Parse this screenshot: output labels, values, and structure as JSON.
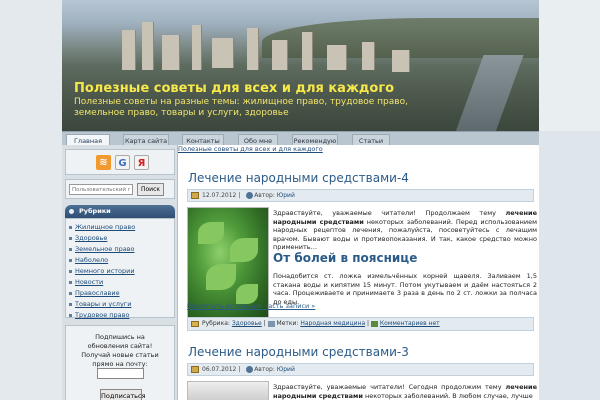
{
  "site": {
    "title": "Полезные советы для всех и для каждого",
    "description": "Полезные советы на разные темы: жилищное право, трудовое право, земельное право, товары и услуги, здоровье"
  },
  "nav": {
    "items": [
      "Главная",
      "Карта сайта",
      "Контакты",
      "Обо мне",
      "Рекомендую",
      "Статьи"
    ],
    "active": "Главная"
  },
  "sidebar": {
    "icons": [
      "rss-icon",
      "google-icon",
      "yandex-icon"
    ],
    "search": {
      "placeholder": "Пользовательский поиск",
      "button": "Поиск"
    },
    "rubrics_title": "Рубрики",
    "rubrics": [
      "Жилищное право",
      "Здоровье",
      "Земельное право",
      "Наболело",
      "Немного истории",
      "Новости",
      "Православие",
      "Товары и услуги",
      "Трудовое право"
    ],
    "subscribe": {
      "text": "Подпишись на обновления сайта! Получай новые статьи прямо на почту:",
      "button": "Подписаться"
    }
  },
  "breadcrumb": "Полезные советы для всех и для каждого",
  "posts": [
    {
      "title": "Лечение народными средствами-4",
      "date": "12.07.2012",
      "author_label": "Автор:",
      "author": "Юрий",
      "intro_start": "Здравствуйте, уважаемые читатели! Продолжаем тему ",
      "intro_bold": "лечение народными средствами",
      "intro_end": " некоторых заболеваний. Перед использованием народных рецептов лечения, пожалуйста, посоветуйтесь с лечащим врачом. Бывают воды и противопоказания. И так, какое средство можно применить…",
      "subtitle": "От болей в пояснице",
      "body": "Понадобится ст. ложка измельчённых корней щавеля. Заливаем 1,5 стакана воды и кипятим 15 минут. Потом укутываем и даём настояться 2 часа. Процеживаете и принимаете 3 раза в день по 2 ст. ложки за полчаса до еды.",
      "more": "Прочитать остальную часть записи »",
      "rubric_label": "Рубрика:",
      "rubric": "Здоровье",
      "tags_label": "Метки:",
      "tags": "Народная медицина",
      "comments": "Комментариев нет"
    },
    {
      "title": "Лечение народными средствами-3",
      "date": "06.07.2012",
      "author_label": "Автор:",
      "author": "Юрий",
      "intro_start": "Здравствуйте, уважаемые читатели! Сегодня продолжим тему ",
      "intro_bold": "лечение народными средствами",
      "intro_end": " некоторых заболеваний. В любом случае, лучше"
    }
  ]
}
